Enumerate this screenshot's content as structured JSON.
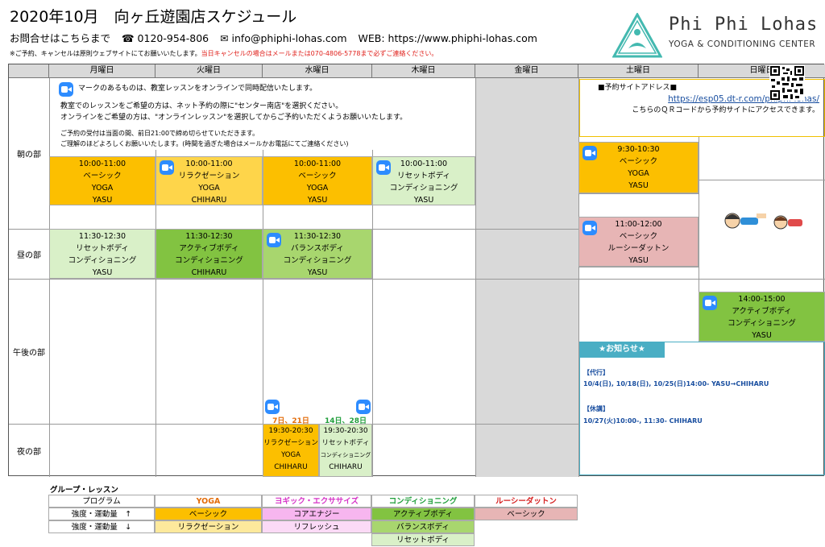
{
  "header": {
    "title": "2020年10月　向ヶ丘遊園店スケジュール",
    "contact_prefix": "お問合せはこちらまで",
    "phone": "☎ 0120-954-806",
    "email": "✉ info@phiphi-lohas.com",
    "web": "WEB: https://www.phiphi-lohas.com",
    "notice_black": "※ご予約、キャンセルは原則ウェブサイトにてお願いいたします。",
    "notice_red": "当日キャンセルの場合はメールまたは070-4806-5778まで必ずご連絡ください。"
  },
  "logo": {
    "name": "Phi Phi Lohas",
    "subtitle": "YOGA & CONDITIONING CENTER",
    "color": "#43b9b0"
  },
  "days": [
    "月曜日",
    "火曜日",
    "水曜日",
    "木曜日",
    "金曜日",
    "土曜日",
    "日曜日"
  ],
  "periods": {
    "morning": "朝の部",
    "noon": "昼の部",
    "afternoon": "午後の部",
    "night": "夜の部"
  },
  "intro": {
    "line1": "マークのあるものは、教室レッスンをオンラインで同時配信いたします。",
    "line2": "教室でのレッスンをご希望の方は、ネット予約の際に\"センター南店\"を選択ください。",
    "line3": "オンラインをご希望の方は、\"オンラインレッスン\"を選択してからご予約いただくようお願いいたします。",
    "line4": "ご予約の受付は当面の間、前日21:00で締め切らせていただきます。",
    "line5": "ご理解のほどよろしくお願いいたします。(時間を過ぎた場合はメールかお電話にてご連絡ください)"
  },
  "reservation": {
    "title": "■予約サイトアドレス■",
    "url": "https://esp05.dt-r.com/phiphi-lohas/",
    "note": "こちらのＱＲコードから予約サイトにアクセスできます。"
  },
  "lessons": {
    "mon_am": {
      "time": "10:00-11:00",
      "l1": "ベーシック",
      "l2": "YOGA",
      "l3": "YASU"
    },
    "tue_am": {
      "time": "10:00-11:00",
      "l1": "リラクゼーション",
      "l2": "YOGA",
      "l3": "CHIHARU"
    },
    "wed_am": {
      "time": "10:00-11:00",
      "l1": "ベーシック",
      "l2": "YOGA",
      "l3": "YASU"
    },
    "thu_am": {
      "time": "10:00-11:00",
      "l1": "リセットボディ",
      "l2": "コンディショニング",
      "l3": "YASU"
    },
    "sat_am": {
      "time": "9:30-10:30",
      "l1": "ベーシック",
      "l2": "YOGA",
      "l3": "YASU"
    },
    "mon_noon": {
      "time": "11:30-12:30",
      "l1": "リセットボディ",
      "l2": "コンディショニング",
      "l3": "YASU"
    },
    "tue_noon": {
      "time": "11:30-12:30",
      "l1": "アクティブボディ",
      "l2": "コンディショニング",
      "l3": "CHIHARU"
    },
    "wed_noon": {
      "time": "11:30-12:30",
      "l1": "バランスボディ",
      "l2": "コンディショニング",
      "l3": "YASU"
    },
    "sat_noon": {
      "time": "11:00-12:00",
      "l1": "ベーシック",
      "l2": "ルーシーダットン",
      "l3": "YASU"
    },
    "sun_pm": {
      "time": "14:00-15:00",
      "l1": "アクティブボディ",
      "l2": "コンディショニング",
      "l3": "YASU"
    },
    "wed_night_a": {
      "time": "19:30-20:30",
      "l1": "リラクゼーション",
      "l2": "YOGA",
      "l3": "CHIHARU"
    },
    "wed_night_b": {
      "time": "19:30-20:30",
      "l1": "リセットボディ",
      "l2": "コンディショニング",
      "l3": "CHIHARU"
    }
  },
  "night_dates": {
    "a": "7日、21日",
    "b": "14日、28日",
    "a_color": "#e36c09",
    "b_color": "#1f9e3a"
  },
  "news": {
    "title": "★お知らせ★",
    "sub_title": "【代行】",
    "sub_text": "10/4(日), 10/18(日), 10/25(日)14:00-  YASU→CHIHARU",
    "off_title": "【休講】",
    "off_text": "10/27(火)10:00-, 11:30- CHIHARU"
  },
  "legend": {
    "title": "グループ・レッスン",
    "program": "プログラム",
    "yoga": "YOGA",
    "yogic": "ヨギック・エクササイズ",
    "cond": "コンディショニング",
    "rusy": "ルーシーダットン",
    "intensity_up": "強度・運動量　↑",
    "intensity_down": "強度・運動量　↓",
    "basic": "ベーシック",
    "core": "コアエナジー",
    "active": "アクティブボディ",
    "rusy_basic": "ベーシック",
    "relax": "リラクゼーション",
    "refresh": "リフレッシュ",
    "balance": "バランスボディ",
    "reset": "リセットボディ",
    "colors": {
      "yoga": "#e36c09",
      "yogic": "#d633c7",
      "cond": "#1f9e3a",
      "rusy": "#d62020"
    }
  }
}
